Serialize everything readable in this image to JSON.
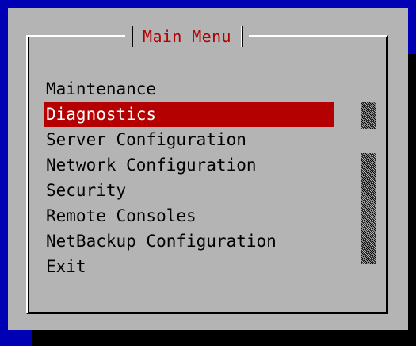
{
  "dialog": {
    "title": "Main Menu"
  },
  "menu": {
    "items": [
      {
        "label": "Maintenance",
        "selected": false
      },
      {
        "label": "Diagnostics",
        "selected": true
      },
      {
        "label": "Server Configuration",
        "selected": false
      },
      {
        "label": "Network Configuration",
        "selected": false
      },
      {
        "label": "Security",
        "selected": false
      },
      {
        "label": "Remote Consoles",
        "selected": false
      },
      {
        "label": "NetBackup Configuration",
        "selected": false
      },
      {
        "label": "Exit",
        "selected": false
      }
    ]
  },
  "colors": {
    "background": "#0000b4",
    "dialog": "#b4b4b4",
    "title_text": "#b40000",
    "selection": "#b40000",
    "selected_text": "#ffffff",
    "text": "#000000",
    "shadow": "#000000"
  },
  "scrollbar": {
    "icon": "stippled-scroll-thumb"
  }
}
